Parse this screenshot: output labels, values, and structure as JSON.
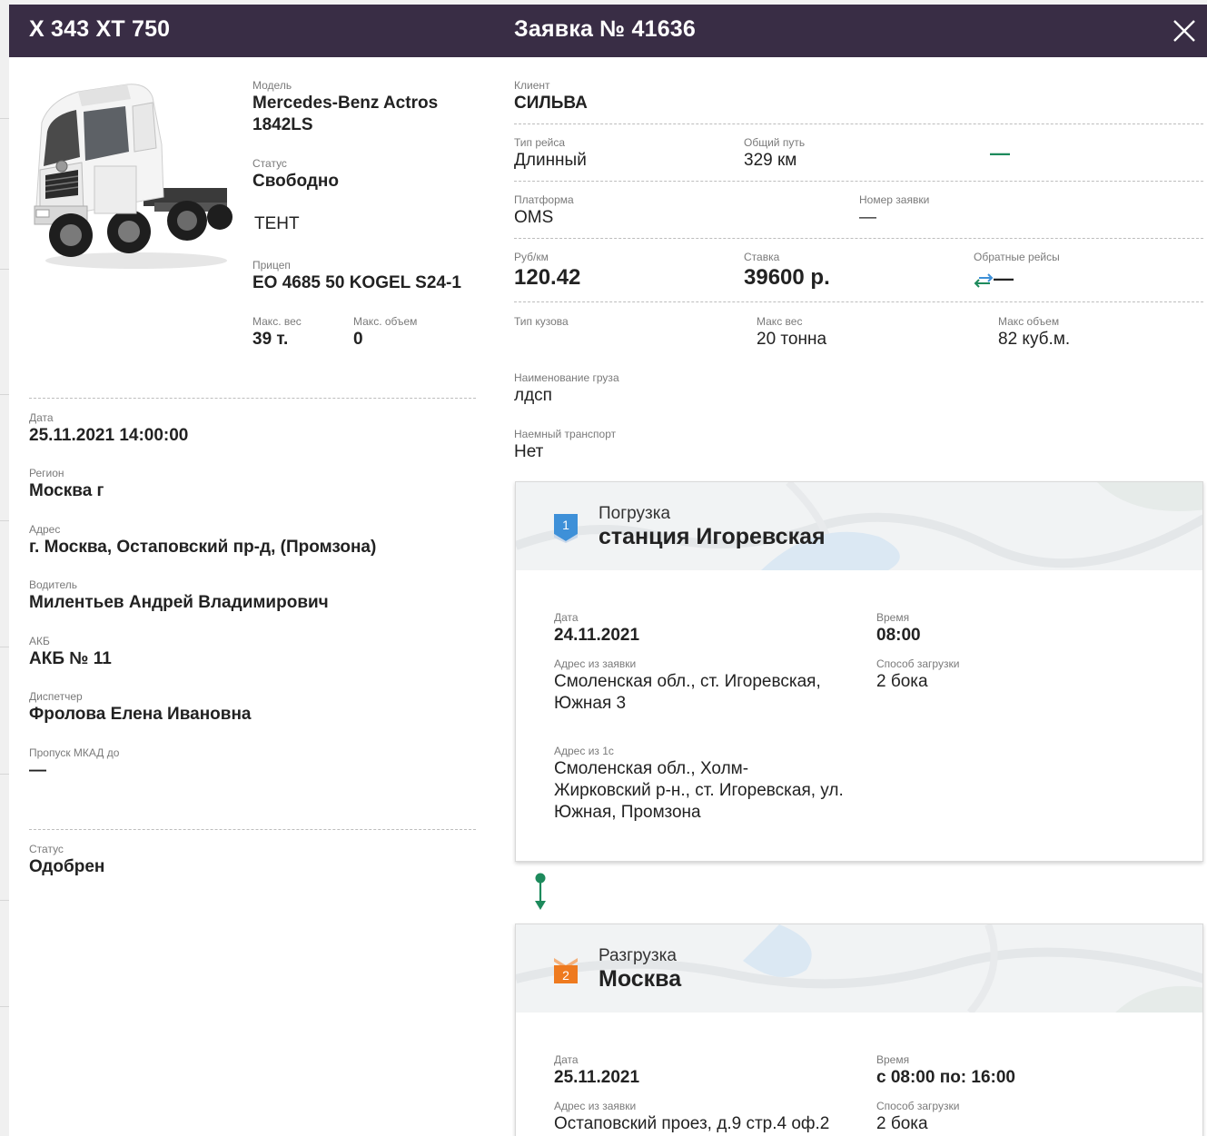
{
  "header": {
    "plate": "Х 343 ХТ 750",
    "order_title": "Заявка № 41636"
  },
  "vehicle": {
    "model_label": "Модель",
    "model_value": "Mercedes-Benz Actros 1842LS",
    "status_label": "Статус",
    "status_value": "Свободно",
    "body_type": "ТЕНТ",
    "trailer_label": "Прицеп",
    "trailer_value": "ЕО 4685 50 KOGEL S24-1",
    "max_weight_label": "Макс. вес",
    "max_weight_value": "39 т.",
    "max_volume_label": "Макс. объем",
    "max_volume_value": "0"
  },
  "info": {
    "date_label": "Дата",
    "date_value": "25.11.2021 14:00:00",
    "region_label": "Регион",
    "region_value": "Москва г",
    "address_label": "Адрес",
    "address_value": "г. Москва, Остаповский пр-д, (Промзона)",
    "driver_label": "Водитель",
    "driver_value": "Милентьев Андрей Владимирович",
    "akb_label": "АКБ",
    "akb_value": "АКБ № 11",
    "dispatcher_label": "Диспетчер",
    "dispatcher_value": "Фролова Елена Ивановна",
    "mkad_label": "Пропуск МКАД до",
    "mkad_value": "—",
    "status_label": "Статус",
    "status_value": "Одобрен"
  },
  "order": {
    "client_label": "Клиент",
    "client_value": "СИЛЬВА",
    "trip_type_label": "Тип рейса",
    "trip_type_value": "Длинный",
    "distance_label": "Общий путь",
    "distance_value": "329 км",
    "trip_dash": "—",
    "platform_label": "Платформа",
    "platform_value": "OMS",
    "order_number_label": "Номер заявки",
    "order_number_value": "—",
    "rate_km_label": "Руб/км",
    "rate_km_value": "120.42",
    "rate_label": "Ставка",
    "rate_value": "39600 р.",
    "return_label": "Обратные рейсы",
    "return_value": "—",
    "body_type_label": "Тип кузова",
    "max_weight_label": "Макс вес",
    "max_weight_value": "20 тонна",
    "max_volume_label": "Макс объем",
    "max_volume_value": "82 куб.м.",
    "cargo_label": "Наименование груза",
    "cargo_value": "лдсп",
    "hired_label": "Наемный транспорт",
    "hired_value": "Нет"
  },
  "stops": [
    {
      "number": "1",
      "type": "Погрузка",
      "place": "станция Игоревская",
      "date_label": "Дата",
      "date_value": "24.11.2021",
      "time_label": "Время",
      "time_value": "08:00",
      "addr_order_label": "Адрес из заявки",
      "addr_order_value": "Смоленская обл., ст. Игоревская, Южная 3",
      "method_label": "Способ загрузки",
      "method_value": "2 бока",
      "addr_1c_label": "Адрес из 1с",
      "addr_1c_value": "Смоленская обл., Холм-Жирковский р-н., ст. Игоревская, ул. Южная, Промзона",
      "icon_color": "#3e90d8"
    },
    {
      "number": "2",
      "type": "Разгрузка",
      "place": "Москва",
      "date_label": "Дата",
      "date_value": "25.11.2021",
      "time_label": "Время",
      "time_value": "с 08:00 по: 16:00",
      "addr_order_label": "Адрес из заявки",
      "addr_order_value": "Остаповский проез, д.9 стр.4 оф.2",
      "method_label": "Способ загрузки",
      "method_value": "2 бока",
      "icon_color": "#ee7a1f"
    }
  ],
  "colors": {
    "header_bg": "#392d45",
    "accent_green": "#1d8a5c"
  }
}
